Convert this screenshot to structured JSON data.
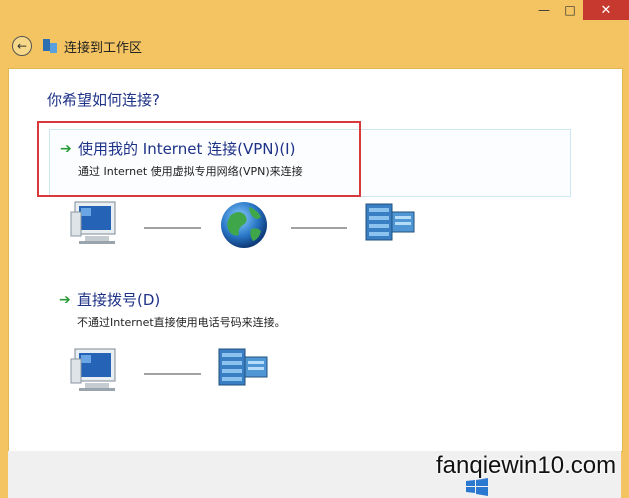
{
  "window": {
    "controls": {
      "minimize": "—",
      "maximize": "□",
      "close": "✕"
    }
  },
  "nav": {
    "title": "连接到工作区"
  },
  "content": {
    "question": "你希望如何连接?",
    "options": [
      {
        "title": "使用我的 Internet 连接(VPN)(I)",
        "description": "通过 Internet 使用虚拟专用网络(VPN)来连接"
      },
      {
        "title": "直接拨号(D)",
        "description": "不通过Internet直接使用电话号码来连接。"
      }
    ]
  },
  "watermark": "fanqiewin10.com",
  "colors": {
    "frame": "#f3c461",
    "link": "#1e3287",
    "arrow": "#2a9a3a",
    "highlight": "#d8393a",
    "close": "#c7392e"
  },
  "icons": [
    "back-arrow-icon",
    "network-folder-icon",
    "computer-icon",
    "globe-icon",
    "server-icon",
    "green-arrow-icon",
    "windows-logo-icon"
  ]
}
